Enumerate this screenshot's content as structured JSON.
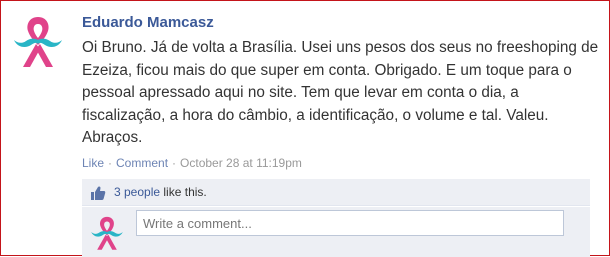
{
  "post": {
    "author": "Eduardo Mamcasz",
    "message": "Oi Bruno. Já de volta a Brasília. Usei uns pesos dos seus no freeshoping de Ezeiza, ficou mais do que super em conta. Obrigado. E um toque para o pessoal apressado aqui no site. Tem que levar em conta o dia, a fiscalização, a hora do câmbio, a identificação, o volume e tal. Valeu. Abraços.",
    "actions": {
      "like_label": "Like",
      "separator": "·",
      "comment_label": "Comment",
      "timestamp": "October 28 at 11:19pm"
    }
  },
  "likes": {
    "people_link": "3 people",
    "suffix": "like this."
  },
  "comment_box": {
    "placeholder": "Write a comment..."
  },
  "colors": {
    "brand_link": "#3b5998",
    "action_link": "#6d84b4",
    "panel_bg": "#edeff4",
    "border_accent": "#c4141a",
    "ribbon_pink": "#e0438a",
    "mustache_teal": "#29b5c6"
  },
  "icons": {
    "avatar": "pink-ribbon-mustache-avatar",
    "likes": "thumbs-up-icon"
  }
}
